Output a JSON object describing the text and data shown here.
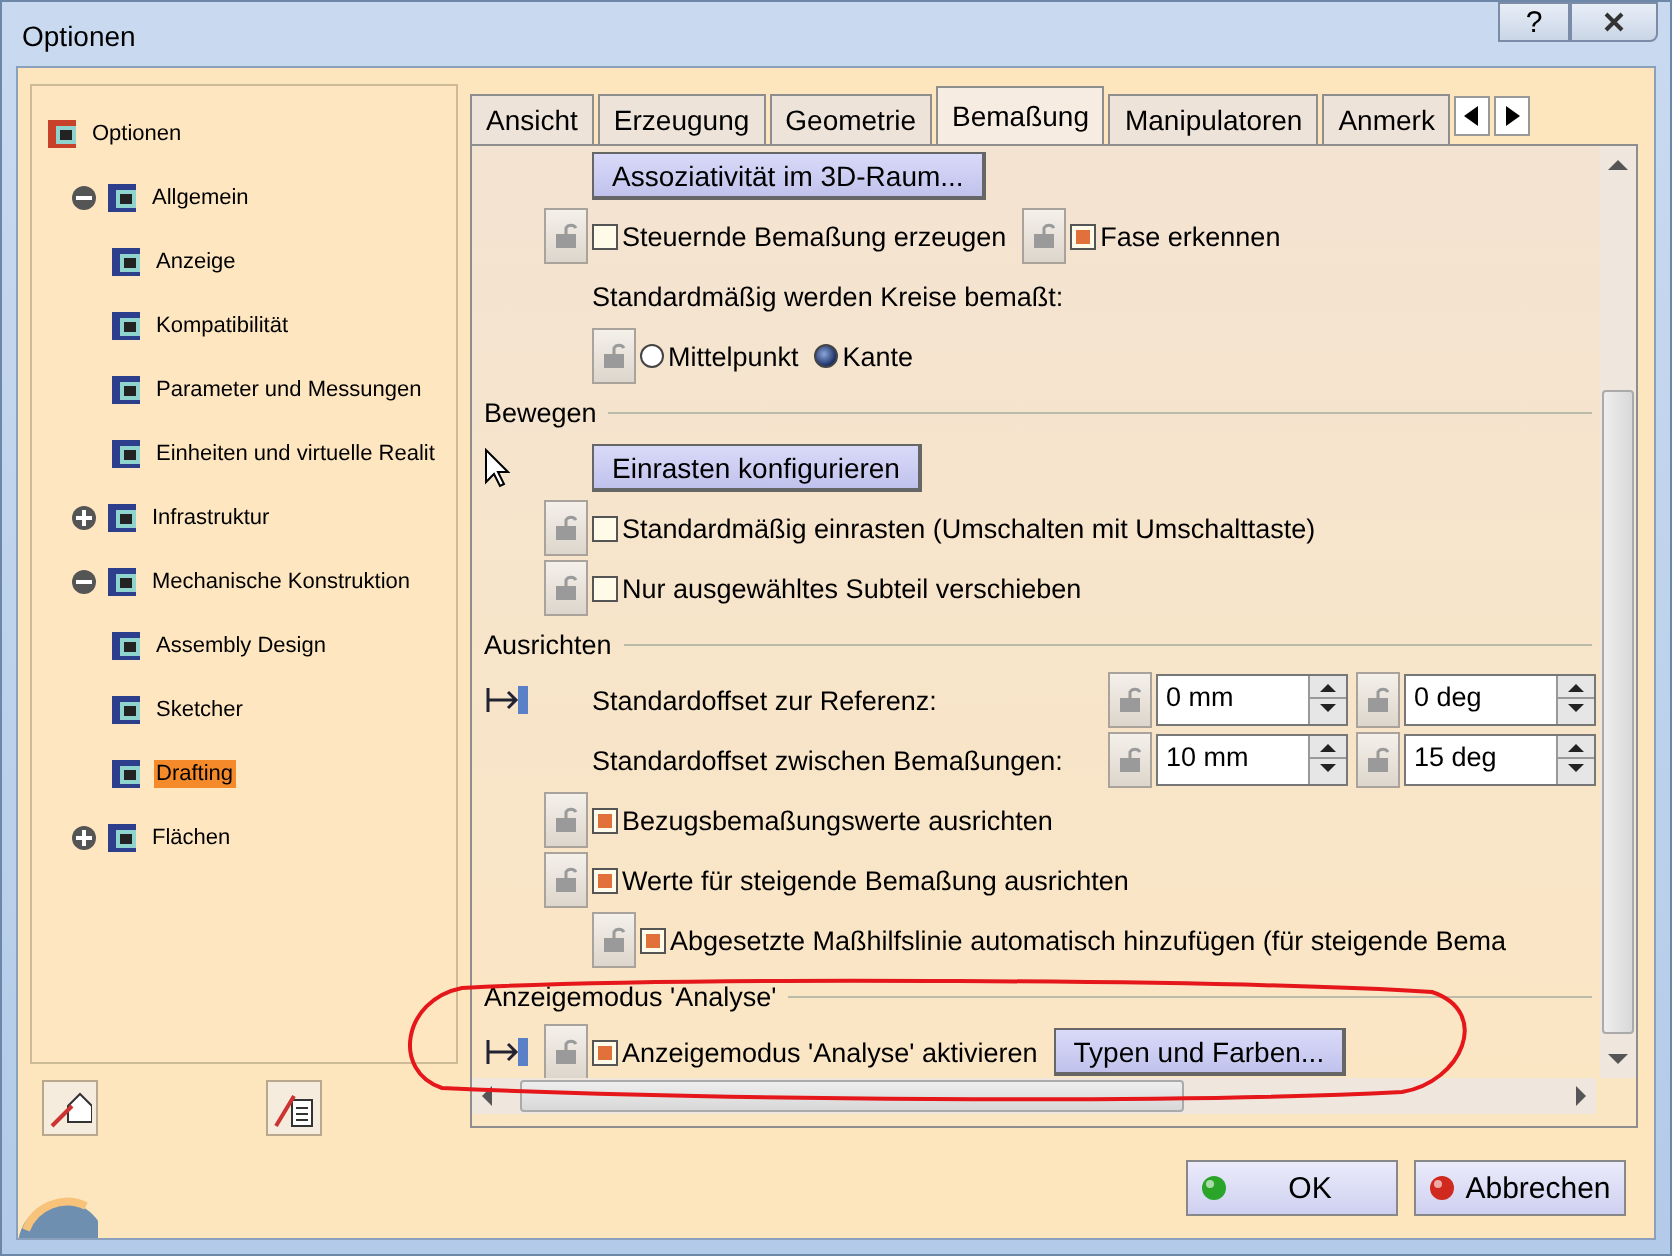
{
  "window": {
    "title": "Optionen",
    "help": "?"
  },
  "tree": {
    "label": "Optionen",
    "selected": false,
    "children": [
      {
        "label": "Allgemein",
        "selected": false,
        "expanded": true,
        "children": [
          {
            "label": "Anzeige",
            "selected": false
          },
          {
            "label": "Kompatibilität",
            "selected": false
          },
          {
            "label": "Parameter und Messungen",
            "selected": false
          },
          {
            "label": "Einheiten und virtuelle Realit",
            "selected": false
          }
        ]
      },
      {
        "label": "Infrastruktur",
        "selected": false,
        "expanded": false
      },
      {
        "label": "Mechanische Konstruktion",
        "selected": false,
        "expanded": true,
        "children": [
          {
            "label": "Assembly Design",
            "selected": false
          },
          {
            "label": "Sketcher",
            "selected": false
          },
          {
            "label": "Drafting",
            "selected": true
          }
        ]
      },
      {
        "label": "Flächen",
        "selected": false,
        "expanded": false
      }
    ]
  },
  "tabs": [
    {
      "label": "Ansicht",
      "selected": false
    },
    {
      "label": "Erzeugung",
      "selected": false
    },
    {
      "label": "Geometrie",
      "selected": false
    },
    {
      "label": "Bemaßung",
      "selected": true
    },
    {
      "label": "Manipulatoren",
      "selected": false
    },
    {
      "label": "Anmerk",
      "selected": false
    }
  ],
  "sections": [
    {
      "rows": [
        {
          "children": [
            {
              "items": [
                {
                  "kind": "button",
                  "label": "Assoziativität im 3D-Raum..."
                }
              ]
            }
          ]
        },
        {
          "items": [
            {
              "kind": "lock"
            },
            {
              "kind": "checkbox",
              "label": "Steuernde Bemaßung erzeugen",
              "checked": false
            },
            {
              "kind": "lock"
            },
            {
              "kind": "checkbox",
              "label": "Fase erkennen",
              "checked": true
            }
          ],
          "children": [
            {
              "items": [
                {
                  "kind": "text",
                  "label": "Standardmäßig werden Kreise bemaßt:"
                }
              ]
            },
            {
              "items": [
                {
                  "kind": "lock"
                },
                {
                  "kind": "radio",
                  "label": "Mittelpunkt",
                  "selected": false
                },
                {
                  "kind": "radio",
                  "label": "Kante",
                  "selected": true
                }
              ]
            }
          ]
        }
      ]
    },
    {
      "title": "Bewegen",
      "rows": [
        {
          "children": [
            {
              "items": [
                {
                  "kind": "pointer"
                },
                {
                  "kind": "button",
                  "label": "Einrasten konfigurieren"
                }
              ]
            }
          ]
        },
        {
          "items": [
            {
              "kind": "lock"
            },
            {
              "kind": "checkbox",
              "label": "Standardmäßig einrasten (Umschalten mit Umschalttaste)",
              "checked": false
            }
          ]
        },
        {
          "items": [
            {
              "kind": "lock"
            },
            {
              "kind": "checkbox",
              "label": "Nur ausgewähltes Subteil verschieben",
              "checked": false
            }
          ]
        }
      ]
    },
    {
      "title": "Ausrichten",
      "rows": [
        {
          "children": [
            {
              "items": [
                {
                  "kind": "icon"
                },
                {
                  "kind": "label",
                  "label": "Standardoffset zur Referenz:"
                },
                {
                  "kind": "lock"
                },
                {
                  "kind": "spin",
                  "value": "0 mm"
                },
                {
                  "kind": "lock"
                },
                {
                  "kind": "spin",
                  "value": "0 deg"
                }
              ]
            },
            {
              "items": [
                {
                  "kind": "label",
                  "label": "Standardoffset zwischen Bemaßungen:"
                },
                {
                  "kind": "lock"
                },
                {
                  "kind": "spin",
                  "value": "10 mm"
                },
                {
                  "kind": "lock"
                },
                {
                  "kind": "spin",
                  "value": "15 deg"
                }
              ]
            }
          ]
        },
        {
          "items": [
            {
              "kind": "lock"
            },
            {
              "kind": "checkbox",
              "label": "Bezugsbemaßungswerte ausrichten",
              "checked": true
            }
          ]
        },
        {
          "items": [
            {
              "kind": "lock"
            },
            {
              "kind": "checkbox",
              "label": "Werte für steigende Bemaßung ausrichten",
              "checked": true
            }
          ],
          "children": [
            {
              "items": [
                {
                  "kind": "lock"
                },
                {
                  "kind": "checkbox",
                  "label": "Abgesetzte Maßhilfslinie automatisch hinzufügen (für steigende Bema",
                  "checked": true
                }
              ]
            }
          ]
        }
      ]
    },
    {
      "title": "Anzeigemodus 'Analyse'",
      "rows": [
        {
          "items": [
            {
              "kind": "icon"
            },
            {
              "kind": "lock"
            },
            {
              "kind": "checkbox",
              "label": "Anzeigemodus 'Analyse' aktivieren",
              "checked": true
            },
            {
              "kind": "button",
              "label": "Typen und Farben..."
            }
          ]
        }
      ]
    }
  ],
  "buttons": [
    {
      "label": "OK",
      "kind": "ok"
    },
    {
      "label": "Abbrechen",
      "kind": "cancel"
    }
  ]
}
